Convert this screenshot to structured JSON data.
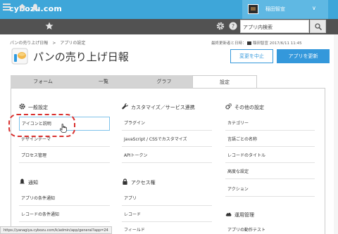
{
  "topbar": {
    "logo": "cybozu.com",
    "user_name": "稲田智宣",
    "user_caret": "∨"
  },
  "toolbar": {
    "search_placeholder": "アプリ内検索"
  },
  "breadcrumb": [
    "パンの売り上げ日報",
    ">",
    "アプリの設定"
  ],
  "page": {
    "title": "パンの売り上げ日報",
    "updated": "最終更新者と日時：",
    "updated_name": "稲田智宣",
    "updated_date": "2017/6/11 11:45",
    "cancel_label": "変更を中止",
    "update_label": "アプリを更新"
  },
  "tabs": [
    "フォーム",
    "一覧",
    "グラフ",
    "設定"
  ],
  "sections": {
    "general": {
      "title": "一般設定",
      "items": [
        "アイコンと説明",
        "デザインテーマ",
        "プロセス管理"
      ]
    },
    "customize": {
      "title": "カスタマイズ／サービス連携",
      "items": [
        "プラグイン",
        "JavaScript / CSSでカスタマイズ",
        "APIトークン"
      ]
    },
    "other": {
      "title": "その他の設定",
      "items": [
        "カテゴリー",
        "言語ごとの名称",
        "レコードのタイトル",
        "高度な設定",
        "アクション"
      ]
    },
    "notify": {
      "title": "通知",
      "items": [
        "アプリの条件通知",
        "レコードの条件通知"
      ]
    },
    "access": {
      "title": "アクセス権",
      "items": [
        "アプリ",
        "レコード",
        "フィールド"
      ]
    },
    "ops": {
      "title": "運用管理",
      "items": [
        "アプリの動作テスト"
      ]
    }
  },
  "status_url": "https://yanagiya.cybozu.com/k/admin/app/general?app=24",
  "colors": {
    "header": "#3ea6d9",
    "toolbar": "#525252",
    "accent": "#3498db",
    "highlight": "#d9302e"
  }
}
